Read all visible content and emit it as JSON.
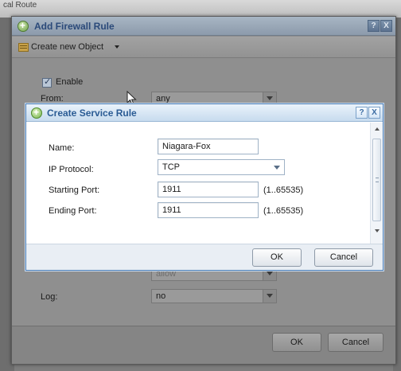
{
  "background": {
    "top_text": "cal Route"
  },
  "outer_dialog": {
    "title": "Add Firewall Rule",
    "help_label": "?",
    "close_label": "X",
    "toolbar": {
      "create_label": "Create new Object"
    },
    "enable_label": "Enable",
    "enable_checked": true,
    "from_label": "From:",
    "from_value": "any",
    "obscured_values": [
      "any",
      "allow"
    ],
    "log_label": "Log:",
    "log_value": "no",
    "ok_label": "OK",
    "cancel_label": "Cancel"
  },
  "inner_dialog": {
    "title": "Create Service Rule",
    "help_label": "?",
    "close_label": "X",
    "fields": {
      "name_label": "Name:",
      "name_value": "Niagara-Fox",
      "protocol_label": "IP Protocol:",
      "protocol_value": "TCP",
      "start_label": "Starting Port:",
      "start_value": "1911",
      "start_range": "(1..65535)",
      "end_label": "Ending Port:",
      "end_value": "1911",
      "end_range": "(1..65535)"
    },
    "ok_label": "OK",
    "cancel_label": "Cancel"
  },
  "colors": {
    "inner_title_text": "#2a5b94",
    "outer_title_text": "#2b4a7a",
    "overlay_gray": "#8f8f8f"
  }
}
